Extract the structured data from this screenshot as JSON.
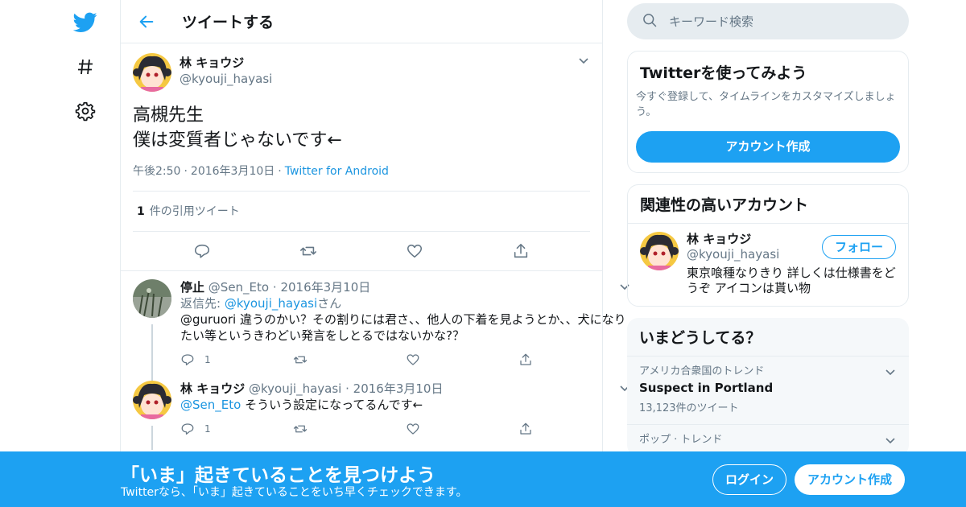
{
  "header": {
    "title": "ツイートする"
  },
  "tweet": {
    "author_name": "林 キョウジ",
    "author_handle": "@kyouji_hayasi",
    "text": "高槻先生\n僕は変質者じゃないです←",
    "time": "午後2:50",
    "date": "2016年3月10日",
    "source": "Twitter for Android",
    "quote_count": "1",
    "quote_label": "件の引用ツイート"
  },
  "replies": [
    {
      "name": "停止",
      "handle": "@Sen_Eto",
      "date": "2016年3月10日",
      "reply_to_prefix": "返信先: ",
      "reply_to_handle": "@kyouji_hayasi",
      "reply_to_suffix": "さん",
      "text": "@guruori 違うのかい？その割りには君さ、、他人の下着を見ようとか、、犬になりたい等というきわどい発言をしとるではないかな?？",
      "reply_count": "1"
    },
    {
      "name": "林 キョウジ",
      "handle": "@kyouji_hayasi",
      "date": "2016年3月10日",
      "mention": "@Sen_Eto",
      "text": " そういう設定になってるんです←",
      "reply_count": "1"
    }
  ],
  "sidebar": {
    "search_placeholder": "キーワード検索",
    "signup_card": {
      "title": "Twitterを使ってみよう",
      "desc": "今すぐ登録して、タイムラインをカスタマイズしましょう。",
      "button": "アカウント作成"
    },
    "related": {
      "title": "関連性の高いアカウント",
      "name": "林 キョウジ",
      "handle": "@kyouji_hayasi",
      "bio": "東京喰種なりきり 詳しくは仕様書をどうぞ アイコンは貰い物",
      "follow": "フォロー"
    },
    "trends": {
      "title": "いまどうしてる？",
      "items": [
        {
          "context": "アメリカ合衆国のトレンド",
          "name": "Suspect in Portland",
          "count": "13,123件のツイート"
        },
        {
          "context": "ポップ · トレンド"
        }
      ]
    }
  },
  "banner": {
    "headline": "「いま」起きていることを見つけよう",
    "sub": "Twitterなら、「いま」起きていることをいち早くチェックできます。",
    "login": "ログイン",
    "signup": "アカウント作成"
  },
  "colors": {
    "accent": "#1da1f2",
    "link": "#1b95e0",
    "muted": "#657786",
    "border": "#e6ecf0"
  },
  "icons": [
    "twitter-bird-icon",
    "hashtag-icon",
    "gear-icon",
    "back-arrow-icon",
    "chevron-down-icon",
    "reply-icon",
    "retweet-icon",
    "like-icon",
    "share-icon",
    "search-icon"
  ]
}
